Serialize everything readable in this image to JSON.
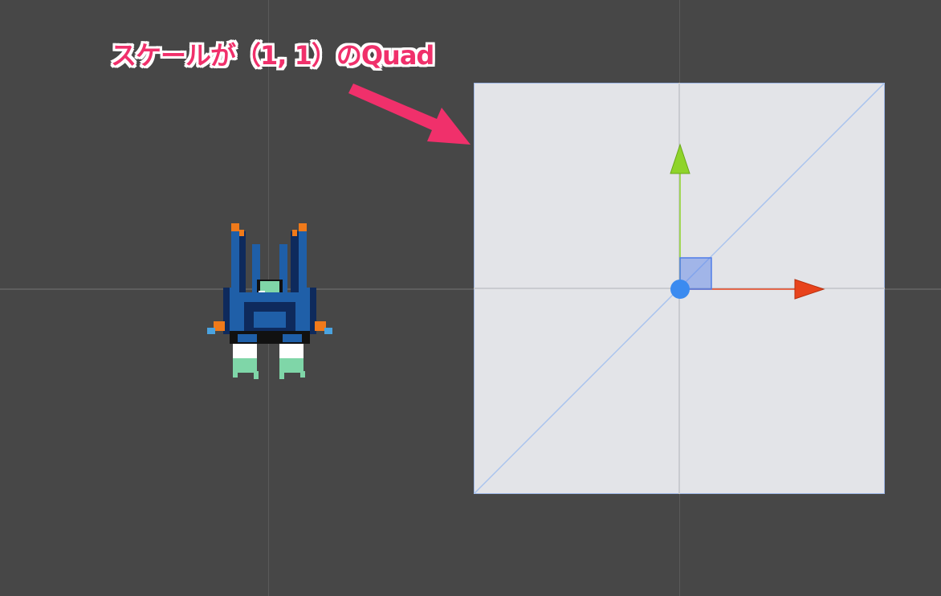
{
  "annotation": {
    "label": "スケールが（1, 1）のQuad",
    "color": "#f0306b",
    "outline_color": "#ffffff"
  },
  "scene_view": {
    "background_color": "#474747",
    "grid_color": "#5a5a5a"
  },
  "quad": {
    "fill_color": "#e3e4e8",
    "edge_color": "#9db6e6",
    "diagonal_color": "#a9c3ee"
  },
  "move_gizmo": {
    "x_axis_color": "#e8431c",
    "y_axis_color": "#8fd42a",
    "plane_handle_color": "#4f7de8",
    "center_color": "#3b8bf0",
    "icons": [
      "x-axis-arrow-icon",
      "y-axis-arrow-icon",
      "xy-plane-handle-icon",
      "pivot-center-icon"
    ]
  },
  "sprite": {
    "name": "robot-sprite-icon",
    "colors": [
      "#1f5fa8",
      "#0e2a5c",
      "#f07a1a",
      "#7fd6a8",
      "#ffffff",
      "#111111"
    ]
  }
}
